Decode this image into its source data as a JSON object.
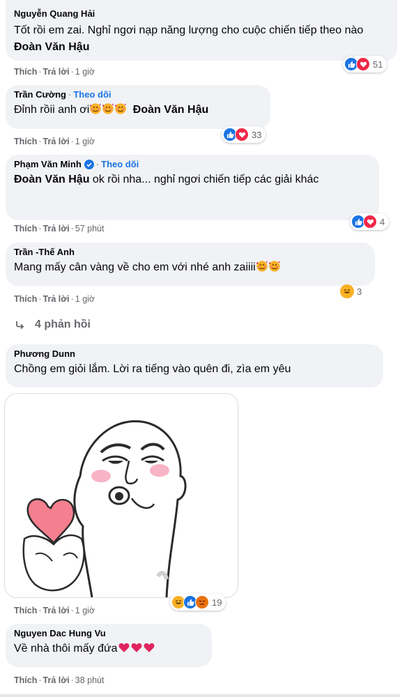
{
  "comments": [
    {
      "author": "Nguyễn Quang Hải",
      "text_plain": "Tốt rồi em zai. Nghỉ ngơi nạp năng lượng cho cuộc chiến tiếp theo nào ",
      "text_bold": "Đoàn Văn Hậu",
      "like_label": "Thích",
      "reply_label": "Trả lời",
      "time": "1 giờ",
      "reactions": [
        "like",
        "love"
      ],
      "reaction_count": "51"
    },
    {
      "author": "Trần Cường",
      "follow": "Theo dõi",
      "text_plain": "Đỉnh rồii anh ơi",
      "text_bold": "Đoàn Văn Hậu",
      "like_label": "Thích",
      "reply_label": "Trả lời",
      "time": "1 giờ",
      "reactions": [
        "like",
        "love"
      ],
      "reaction_count": "33"
    },
    {
      "author": "Phạm Văn Minh",
      "follow": "Theo dõi",
      "text_bold": "Đoàn Văn Hậu",
      "text_plain": " ok rồi nha... nghỉ ngơi chiến tiếp các giải khác",
      "like_label": "Thích",
      "reply_label": "Trả lời",
      "time": "57 phút",
      "reactions": [
        "like",
        "love"
      ],
      "reaction_count": "4"
    },
    {
      "author": "Trần -Thế Anh",
      "text_plain": "Mang mấy cân vàng về cho em với nhé anh zaiiii",
      "like_label": "Thích",
      "reply_label": "Trả lời",
      "time": "1 giờ",
      "reactions": [
        "haha"
      ],
      "reaction_count": "3"
    },
    {
      "author": "Phương Dunn",
      "text_plain": "Chồng em giỏi lắm. Lời ra tiếng vào quên đi, zìa em yêu",
      "like_label": "Thích",
      "reply_label": "Trả lời",
      "time": "1 giờ",
      "reactions": [
        "haha",
        "like",
        "angry"
      ],
      "reaction_count": "19"
    },
    {
      "author": "Nguyen Dac Hung Vu",
      "text_plain": "Về nhà thôi mấy đứa",
      "like_label": "Thích",
      "reply_label": "Trả lời",
      "time": "38 phút"
    }
  ],
  "replies_link": "4 phản hồi",
  "colors": {
    "link": "#1b74e4",
    "bubble": "#f0f2f5",
    "meta": "#65676b",
    "like": "#1b74e4",
    "love": "#f02849",
    "haha": "#f7b125"
  }
}
